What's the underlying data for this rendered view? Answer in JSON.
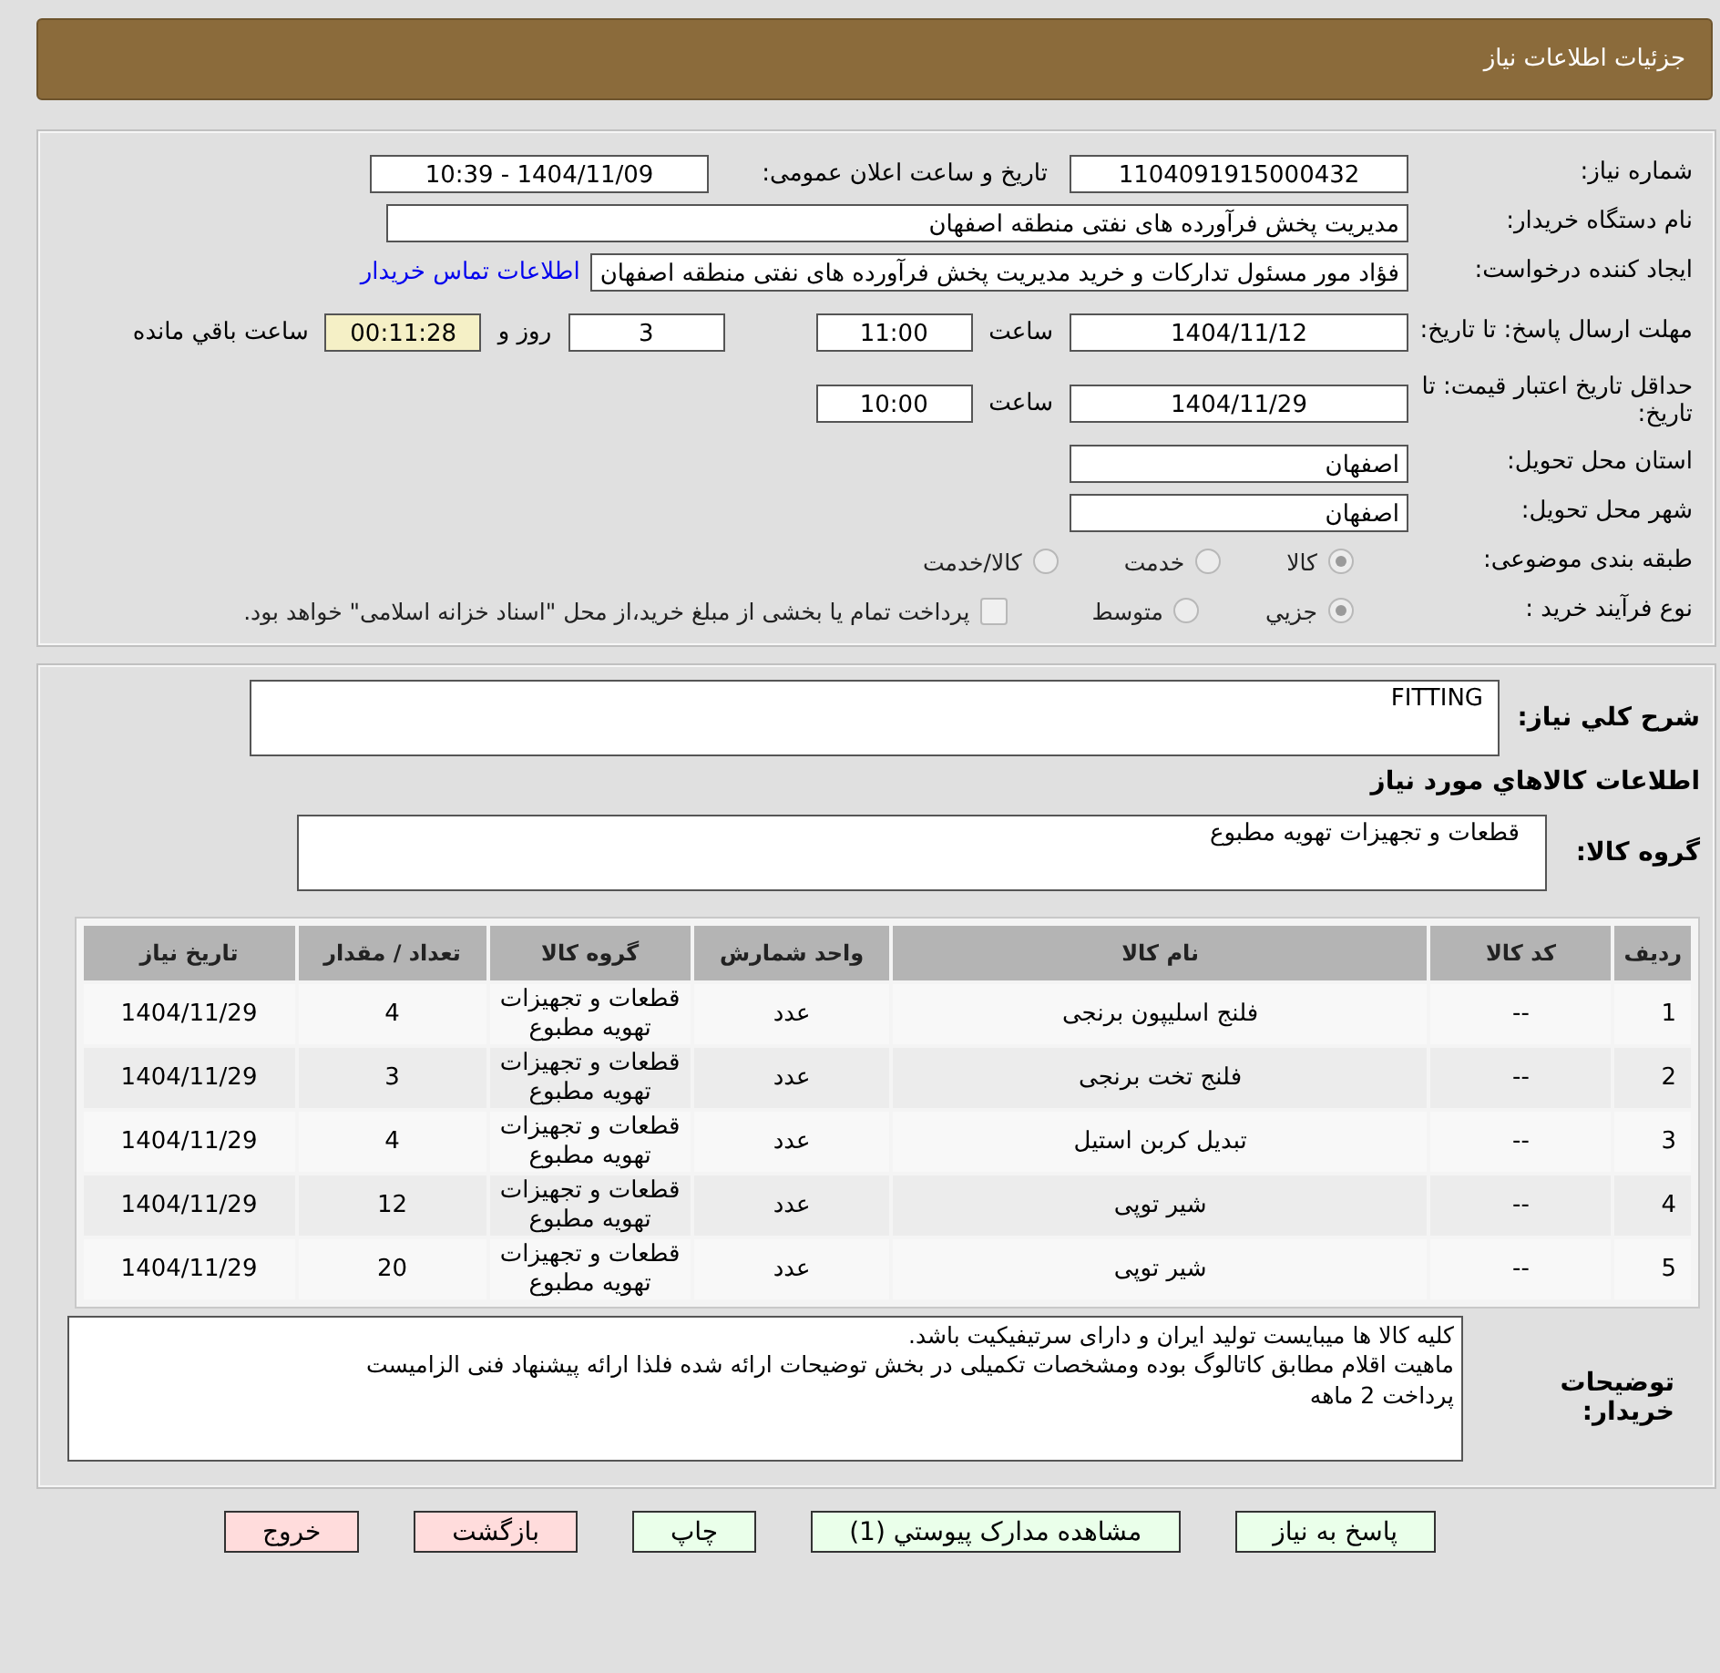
{
  "header": {
    "title": "جزئیات اطلاعات نیاز"
  },
  "details": {
    "need_number": {
      "label": "شماره نیاز:",
      "value": "1104091915000432"
    },
    "announce": {
      "label": "تاریخ و ساعت اعلان عمومی:",
      "value": "1404/11/09 - 10:39"
    },
    "buyer": {
      "label": "نام دستگاه خریدار:",
      "value": "مدیریت پخش فرآورده های نفتی منطقه اصفهان"
    },
    "creator": {
      "label": "ایجاد کننده درخواست:",
      "value": "فؤاد مور مسئول تدارکات و خرید مدیریت پخش فرآورده های نفتی منطقه اصفهان",
      "link": "اطلاعات تماس خریدار"
    },
    "deadline": {
      "label": "مهلت ارسال پاسخ: تا تاریخ:",
      "date": "1404/11/12",
      "time_label": "ساعت",
      "time": "11:00",
      "days": "3",
      "days_label": "روز و",
      "remaining": "00:11:28",
      "remaining_label": "ساعت باقي مانده"
    },
    "validity": {
      "label": "حداقل تاریخ اعتبار قیمت: تا تاریخ:",
      "date": "1404/11/29",
      "time_label": "ساعت",
      "time": "10:00"
    },
    "province": {
      "label": "استان محل تحویل:",
      "value": "اصفهان"
    },
    "city": {
      "label": "شهر محل تحویل:",
      "value": "اصفهان"
    },
    "category": {
      "label": "طبقه بندی موضوعی:",
      "options": [
        {
          "label": "کالا",
          "selected": true
        },
        {
          "label": "خدمت",
          "selected": false
        },
        {
          "label": "کالا/خدمت",
          "selected": false
        }
      ]
    },
    "process": {
      "label": "نوع فرآیند خرید :",
      "options": [
        {
          "label": "جزيي",
          "selected": true
        },
        {
          "label": "متوسط",
          "selected": false
        }
      ],
      "treasury": {
        "label": "پرداخت تمام یا بخشی از مبلغ خرید،از محل \"اسناد خزانه اسلامی\" خواهد بود.",
        "checked": false
      }
    }
  },
  "goods": {
    "description_label": "شرح کلي نیاز:",
    "description": "FITTING",
    "section_title": "اطلاعات کالاهاي مورد نیاز",
    "group_label": "گروه کالا:",
    "group": "قطعات و تجهیزات تهویه مطبوع",
    "table": {
      "columns": [
        "ردیف",
        "کد کالا",
        "نام کالا",
        "واحد شمارش",
        "گروه کالا",
        "تعداد / مقدار",
        "تاریخ نیاز"
      ],
      "rows": [
        [
          "1",
          "--",
          "فلنج اسلیپون برنجی",
          "عدد",
          "قطعات و تجهیزات تهویه مطبوع",
          "4",
          "1404/11/29"
        ],
        [
          "2",
          "--",
          "فلنج تخت برنجی",
          "عدد",
          "قطعات و تجهیزات تهویه مطبوع",
          "3",
          "1404/11/29"
        ],
        [
          "3",
          "--",
          "تبدیل کربن استیل",
          "عدد",
          "قطعات و تجهیزات تهویه مطبوع",
          "4",
          "1404/11/29"
        ],
        [
          "4",
          "--",
          "شیر توپی",
          "عدد",
          "قطعات و تجهیزات تهویه مطبوع",
          "12",
          "1404/11/29"
        ],
        [
          "5",
          "--",
          "شیر توپی",
          "عدد",
          "قطعات و تجهیزات تهویه مطبوع",
          "20",
          "1404/11/29"
        ]
      ]
    },
    "notes_label": "توضیحات خریدار:",
    "notes": [
      "کلیه کالا ها میبایست تولید ایران و دارای سرتیفیکیت باشد.",
      "ماهیت اقلام مطابق کاتالوگ بوده ومشخصات تکمیلی در بخش توضیحات ارائه شده فلذا ارائه پیشنهاد فنی الزامیست",
      "پرداخت 2 ماهه"
    ]
  },
  "buttons": [
    {
      "label": "پاسخ به نیاز",
      "kind": "action"
    },
    {
      "label": "مشاهده مدارک پیوستي (1)",
      "kind": "action"
    },
    {
      "label": "چاپ",
      "kind": "action"
    },
    {
      "label": "بازگشت",
      "kind": "exit"
    },
    {
      "label": "خروج",
      "kind": "exit"
    }
  ]
}
